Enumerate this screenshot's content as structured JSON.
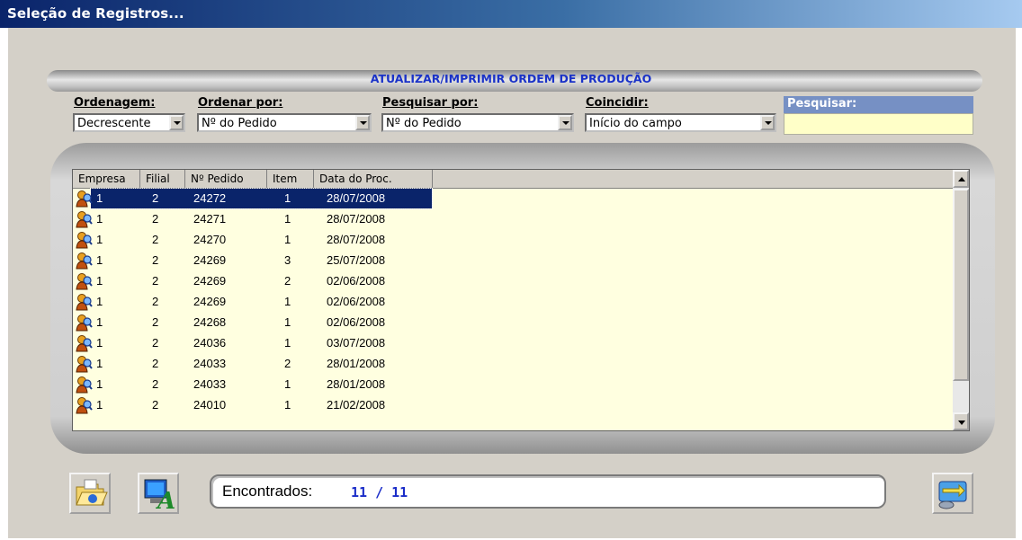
{
  "window": {
    "title": "Seleção de Registros..."
  },
  "header": {
    "title": "ATUALIZAR/IMPRIMIR ORDEM DE PRODUÇÃO"
  },
  "filters": {
    "ordenagem": {
      "label": "Ordenagem:",
      "value": "Decrescente"
    },
    "ordenar_por": {
      "label": "Ordenar por:",
      "value": "Nº do Pedido"
    },
    "pesquisar_por": {
      "label": "Pesquisar por:",
      "value": "Nº do Pedido"
    },
    "coincidir": {
      "label": "Coincidir:",
      "value": "Início do campo"
    },
    "pesquisar": {
      "label": "Pesquisar:",
      "value": ""
    }
  },
  "grid": {
    "columns": [
      "Empresa",
      "Filial",
      "Nº Pedido",
      "Item",
      "Data do Proc."
    ],
    "rows": [
      [
        "1",
        "2",
        "24272",
        "1",
        "28/07/2008"
      ],
      [
        "1",
        "2",
        "24271",
        "1",
        "28/07/2008"
      ],
      [
        "1",
        "2",
        "24270",
        "1",
        "28/07/2008"
      ],
      [
        "1",
        "2",
        "24269",
        "3",
        "25/07/2008"
      ],
      [
        "1",
        "2",
        "24269",
        "2",
        "02/06/2008"
      ],
      [
        "1",
        "2",
        "24269",
        "1",
        "02/06/2008"
      ],
      [
        "1",
        "2",
        "24268",
        "1",
        "02/06/2008"
      ],
      [
        "1",
        "2",
        "24036",
        "1",
        "03/07/2008"
      ],
      [
        "1",
        "2",
        "24033",
        "2",
        "28/01/2008"
      ],
      [
        "1",
        "2",
        "24033",
        "1",
        "28/01/2008"
      ],
      [
        "1",
        "2",
        "24010",
        "1",
        "21/02/2008"
      ]
    ],
    "selected_row": 0,
    "row_icon": "person-search-icon"
  },
  "footer": {
    "found_label": "Encontrados:",
    "found_value": "11 / 11",
    "buttons": [
      "open-folder-icon",
      "monitor-font-icon",
      "exchange-icon"
    ]
  },
  "colors": {
    "title_text": "#1a32c8",
    "selection": "#0a246a",
    "grid_bg": "#ffffe0",
    "search_bg": "#ffffc8"
  }
}
